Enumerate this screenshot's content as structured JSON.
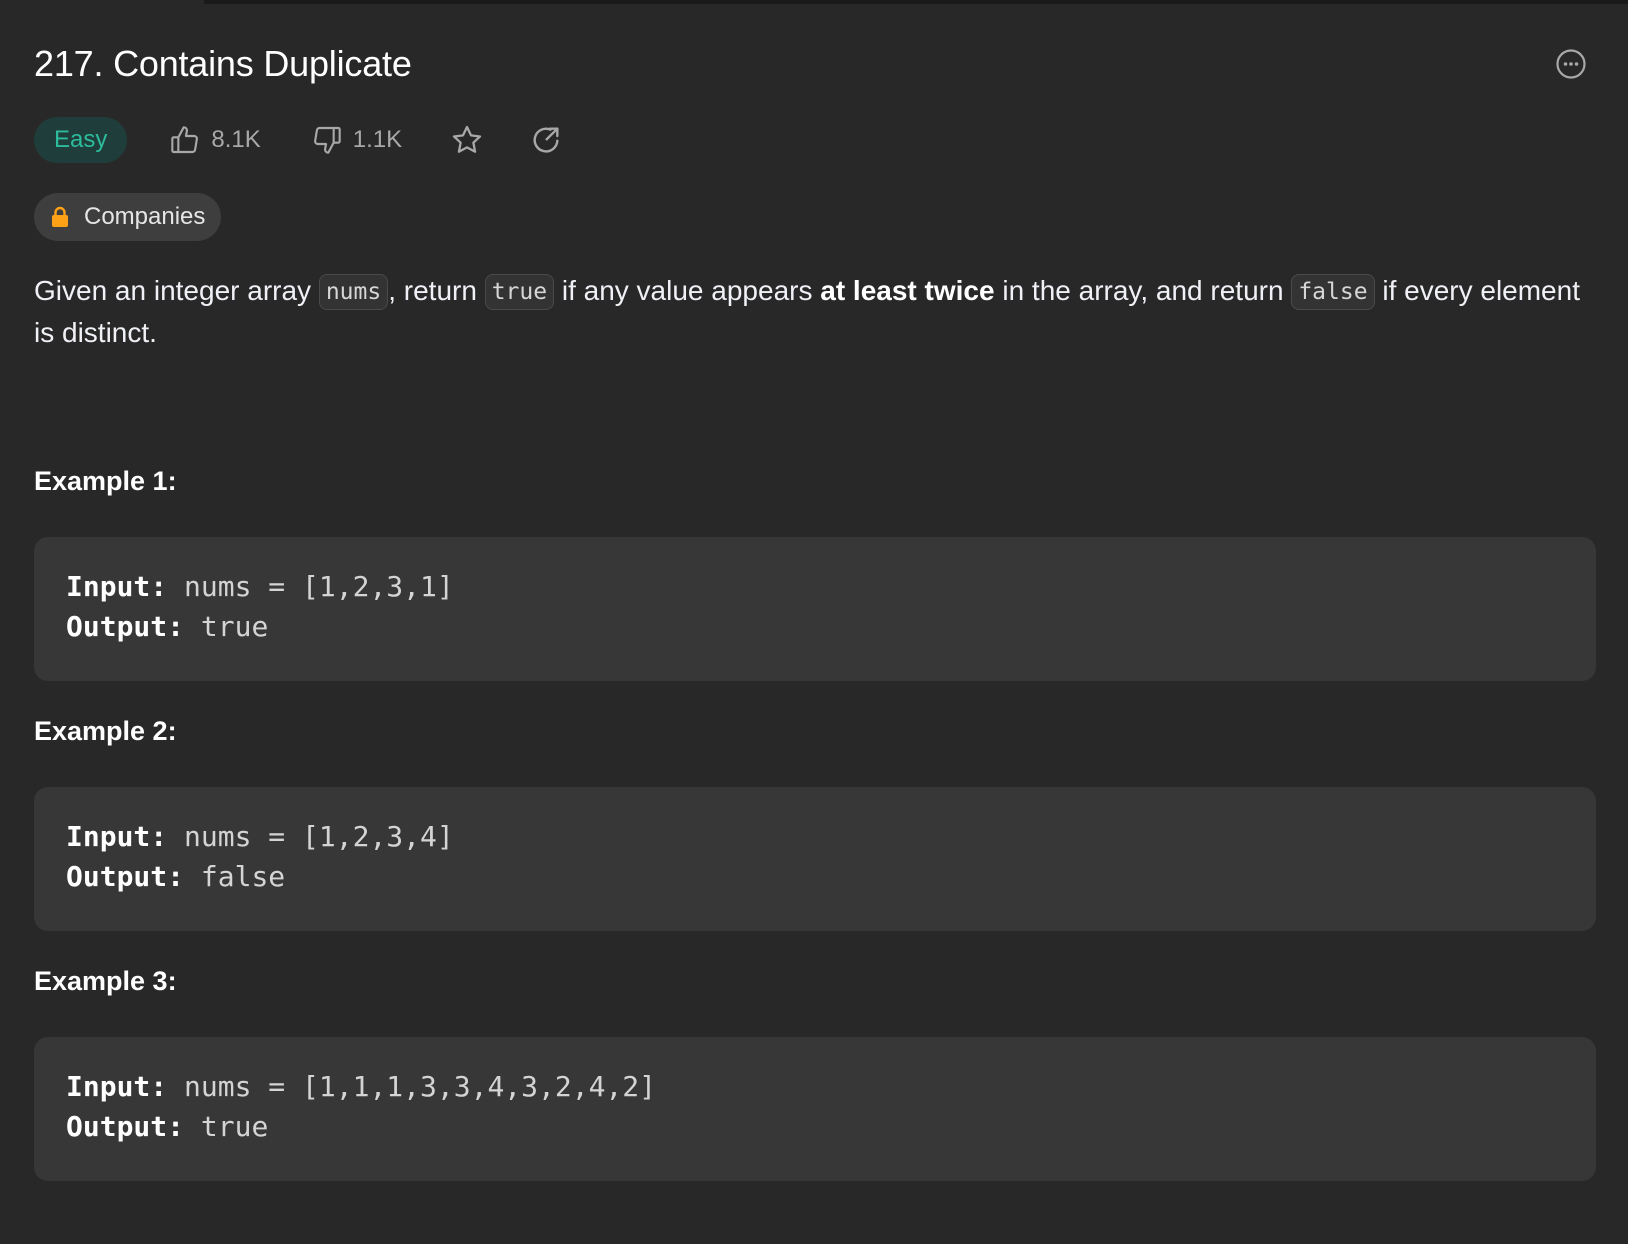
{
  "problem": {
    "title": "217. Contains Duplicate",
    "difficulty": "Easy",
    "likes": "8.1K",
    "dislikes": "1.1K",
    "companies_label": "Companies",
    "icons": {
      "like": "thumbs-up-icon",
      "dislike": "thumbs-down-icon",
      "favorite": "star-icon",
      "share": "share-icon",
      "more": "more-options-icon",
      "companies": "lock-icon"
    }
  },
  "description": {
    "t1": "Given an integer array ",
    "c1": "nums",
    "t2": ", return ",
    "c2": "true",
    "t3": " if any value appears ",
    "b1": "at least twice",
    "t4": " in the array, and return ",
    "c3": "false",
    "t5": " if every element is distinct."
  },
  "examples": [
    {
      "title": "Example 1:",
      "input_label": "Input:",
      "input_value": " nums = [1,2,3,1]",
      "output_label": "Output:",
      "output_value": " true"
    },
    {
      "title": "Example 2:",
      "input_label": "Input:",
      "input_value": " nums = [1,2,3,4]",
      "output_label": "Output:",
      "output_value": " false"
    },
    {
      "title": "Example 3:",
      "input_label": "Input:",
      "input_value": " nums = [1,1,1,3,3,4,3,2,4,2]",
      "output_label": "Output:",
      "output_value": " true"
    }
  ],
  "colors": {
    "background": "#282828",
    "difficulty_easy": "#2cbb9c",
    "difficulty_bg": "#1f3d3a",
    "lock": "#ffa116",
    "code_block_bg": "#373737"
  }
}
